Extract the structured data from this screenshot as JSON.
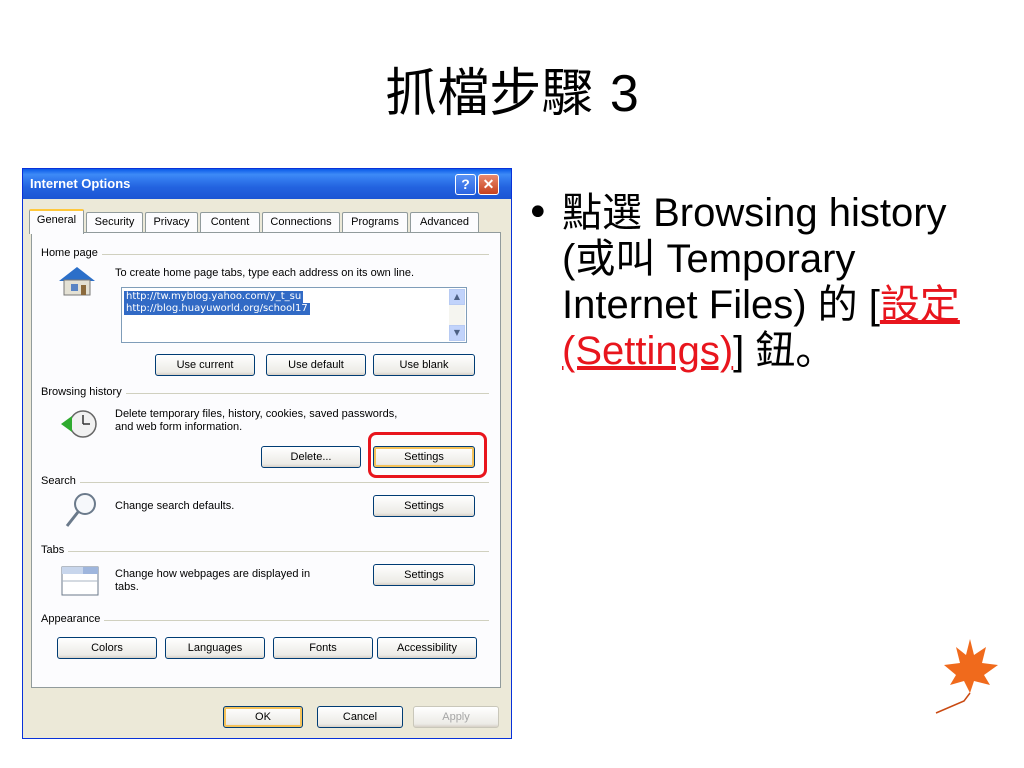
{
  "slide": {
    "title_cjk": "抓檔步驟",
    "title_num": "3",
    "bullet": {
      "part1_cjk": "點選",
      "part2": " Browsing history (",
      "part3_cjk": "或叫",
      "part4": " Temporary Internet Files) ",
      "part5_cjk": "的",
      "part6": " [",
      "link_cjk": "設定",
      "link_en": "(Settings)",
      "part7": "] ",
      "part8_cjk": "鈕。"
    }
  },
  "dialog": {
    "title": "Internet Options",
    "help_label": "?",
    "close_label": "✕",
    "tabs": [
      "General",
      "Security",
      "Privacy",
      "Content",
      "Connections",
      "Programs",
      "Advanced"
    ],
    "home_page": {
      "label": "Home page",
      "description": "To create home page tabs, type each address on its own line.",
      "addresses": [
        "http://tw.myblog.yahoo.com/y_t_su",
        "http://blog.huayuworld.org/school17"
      ],
      "buttons": [
        "Use current",
        "Use default",
        "Use blank"
      ]
    },
    "browsing_history": {
      "label": "Browsing history",
      "description_line1": "Delete temporary files, history, cookies, saved passwords,",
      "description_line2": "and web form information.",
      "delete_label": "Delete...",
      "settings_label": "Settings"
    },
    "search": {
      "label": "Search",
      "description": "Change search defaults.",
      "settings_label": "Settings"
    },
    "tabs_group": {
      "label": "Tabs",
      "description_line1": "Change how webpages are displayed in",
      "description_line2": "tabs.",
      "settings_label": "Settings"
    },
    "appearance": {
      "label": "Appearance",
      "buttons": [
        "Colors",
        "Languages",
        "Fonts",
        "Accessibility"
      ]
    },
    "footer": {
      "ok_label": "OK",
      "cancel_label": "Cancel",
      "apply_label": "Apply"
    }
  },
  "colors": {
    "highlight": "#e8151d",
    "link": "#e8151d",
    "titlebar": "#2363e0"
  }
}
